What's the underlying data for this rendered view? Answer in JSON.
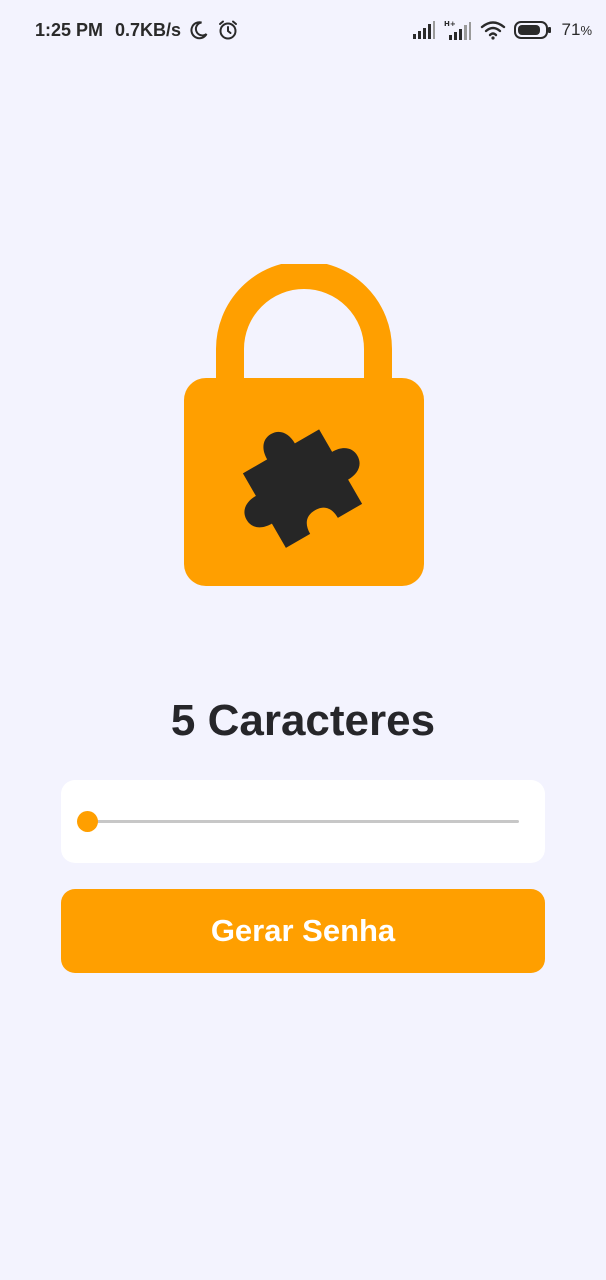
{
  "status_bar": {
    "time": "1:25 PM",
    "network_speed": "0.7KB/s",
    "battery_percent": "71",
    "battery_unit": "%",
    "icons": [
      "moon-icon",
      "alarm-icon",
      "signal-icon",
      "signal-hplus-icon",
      "wifi-icon",
      "battery-icon"
    ]
  },
  "hero": {
    "icon": "padlock-puzzle-icon"
  },
  "main": {
    "length_title": "5 Caracteres",
    "slider": {
      "value": 5,
      "min": 5,
      "max": 20,
      "fraction": 0.0
    },
    "generate_button": "Gerar Senha"
  },
  "colors": {
    "background": "#f3f3fe",
    "accent": "#ff9f00",
    "text": "#26262a",
    "card": "#ffffff",
    "track": "#c7c7c7"
  }
}
